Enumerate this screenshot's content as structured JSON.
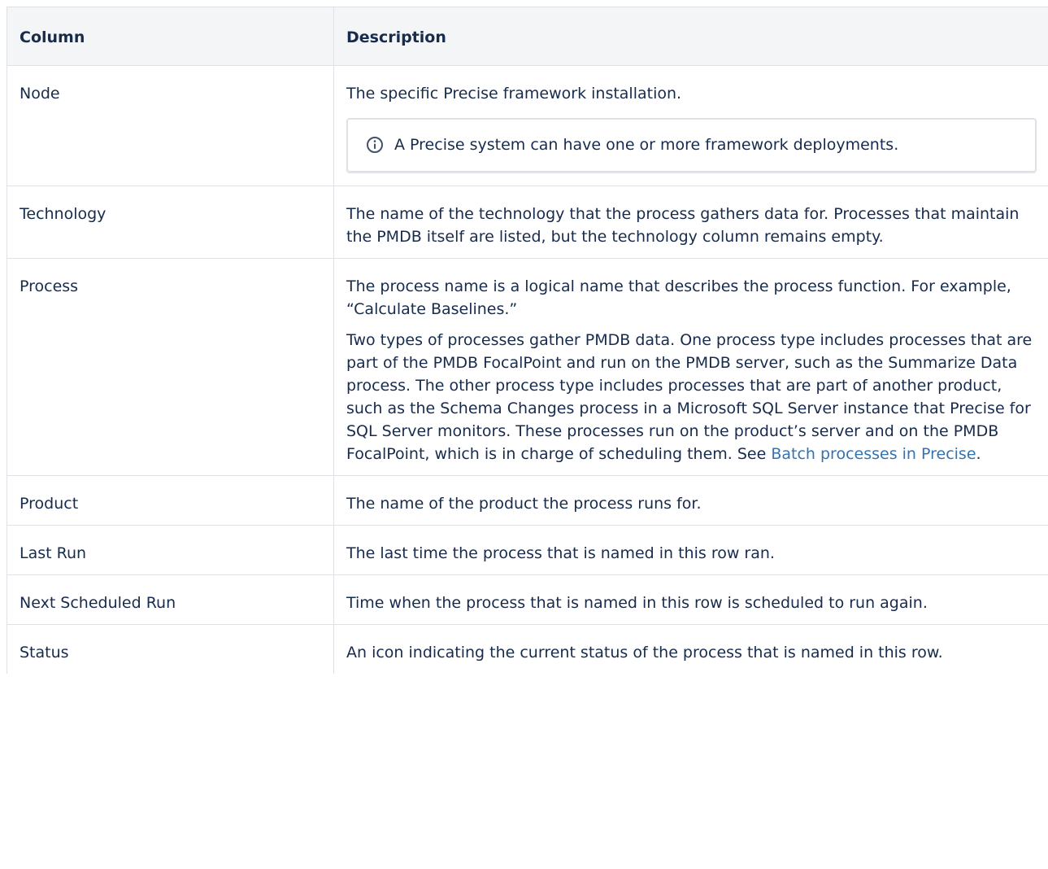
{
  "table": {
    "headers": {
      "column": "Column",
      "description": "Description"
    },
    "rows": [
      {
        "name": "Node",
        "description": "The specific Precise framework installation.",
        "info_note": "A Precise system can have one or more framework deployments."
      },
      {
        "name": "Technology",
        "description": "The name of the technology that the process gathers data for. Processes that maintain the PMDB itself are listed, but the technology column remains empty."
      },
      {
        "name": "Process",
        "description_p1": "The process name is a logical name that describes the process function. For example, “Calculate Baselines.”",
        "description_p2": "Two types of processes gather PMDB data. One process type includes processes that are part of the PMDB FocalPoint and run on the PMDB server, such as the Summarize Data process. The other process type includes processes that are part of another product, such as the Schema Changes process in a Microsoft SQL Server instance that Precise for SQL Server monitors. These processes run on the product’s server and on the PMDB FocalPoint, which is in charge of scheduling them. See ",
        "link_text": "Batch processes in Precise",
        "description_p2_end": "."
      },
      {
        "name": "Product",
        "description": "The name of the product the process runs for."
      },
      {
        "name": "Last Run",
        "description": "The last time the process that is named in this row ran."
      },
      {
        "name": "Next Scheduled Run",
        "description": "Time when the process that is named in this row is scheduled to run again."
      },
      {
        "name": "Status",
        "description": "An icon indicating the current status of the process that is named in this row."
      }
    ]
  },
  "colors": {
    "text": "#172b4d",
    "header_bg": "#f4f5f7",
    "border": "#dfe1e6",
    "link": "#3572b0"
  },
  "icons": {
    "info": "info-icon"
  }
}
